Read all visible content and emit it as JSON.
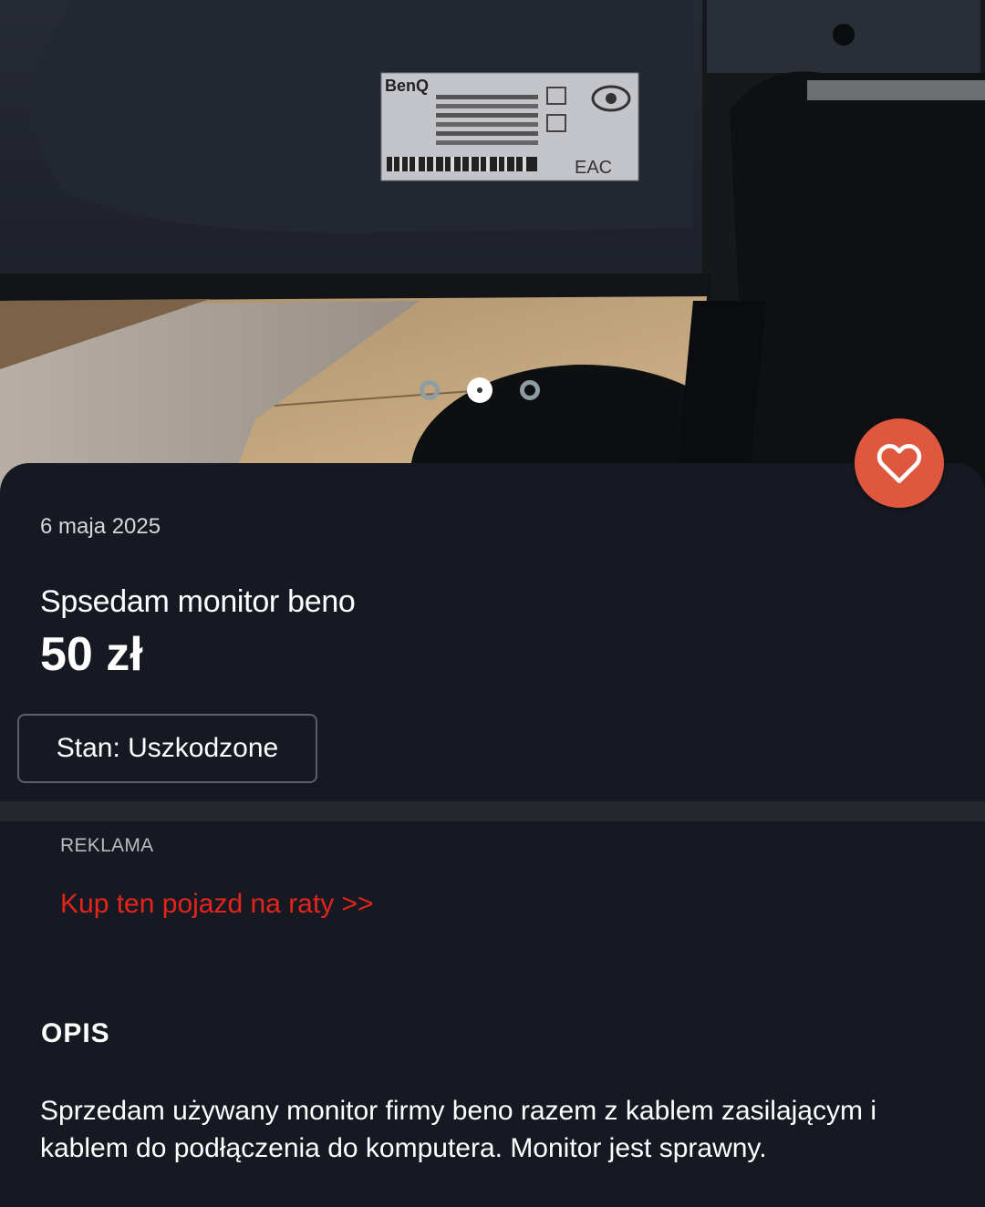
{
  "listing": {
    "date": "6 maja 2025",
    "title": "Spsedam monitor beno",
    "price": "50 zł",
    "condition": "Stan: Uszkodzone"
  },
  "carousel": {
    "count": 3,
    "active_index": 1
  },
  "ad": {
    "label": "REKLAMA",
    "link_text": "Kup ten pojazd na raty >>"
  },
  "description": {
    "heading": "OPIS",
    "text": "Sprzedam używany monitor firmy beno razem z kablem zasilającym i kablem do podłączenia do komputera. Monitor jest sprawny."
  },
  "photo": {
    "label_brand": "BenQ",
    "label_certification": "EAC"
  },
  "icons": {
    "favorite": "heart-outline-icon"
  },
  "colors": {
    "background": "#161922",
    "favorite_button": "#e0573f",
    "ad_link": "#e5241b",
    "divider": "#24272d"
  }
}
